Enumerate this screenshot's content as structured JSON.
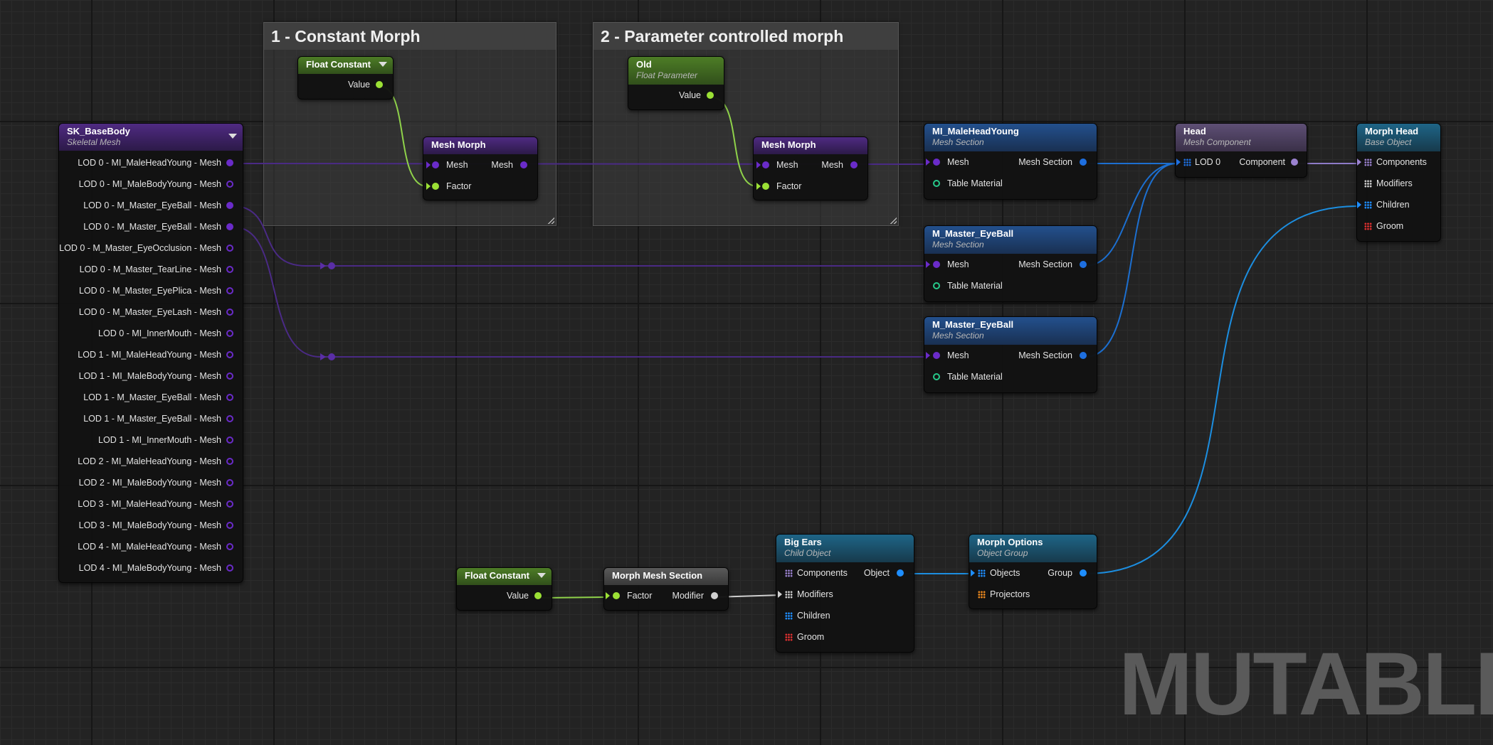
{
  "comments": [
    {
      "title": "1 - Constant Morph"
    },
    {
      "title": "2 - Parameter controlled morph"
    }
  ],
  "sk_base_body": {
    "title": "SK_BaseBody",
    "subtitle": "Skeletal Mesh",
    "outputs": [
      "LOD 0 - MI_MaleHeadYoung - Mesh",
      "LOD 0 - MI_MaleBodyYoung - Mesh",
      "LOD 0 - M_Master_EyeBall - Mesh",
      "LOD 0 - M_Master_EyeBall - Mesh",
      "LOD 0 - M_Master_EyeOcclusion - Mesh",
      "LOD 0 - M_Master_TearLine - Mesh",
      "LOD 0 - M_Master_EyePlica - Mesh",
      "LOD 0 - M_Master_EyeLash - Mesh",
      "LOD 0 - MI_InnerMouth - Mesh",
      "LOD 1 - MI_MaleHeadYoung - Mesh",
      "LOD 1 - MI_MaleBodyYoung - Mesh",
      "LOD 1 - M_Master_EyeBall - Mesh",
      "LOD 1 - M_Master_EyeBall - Mesh",
      "LOD 1 - MI_InnerMouth - Mesh",
      "LOD 2 - MI_MaleHeadYoung - Mesh",
      "LOD 2 - MI_MaleBodyYoung - Mesh",
      "LOD 3 - MI_MaleHeadYoung - Mesh",
      "LOD 3 - MI_MaleBodyYoung - Mesh",
      "LOD 4 - MI_MaleHeadYoung - Mesh",
      "LOD 4 - MI_MaleBodyYoung - Mesh"
    ]
  },
  "float_constant_1": {
    "title": "Float Constant",
    "value": "Value"
  },
  "mesh_morph_1": {
    "title": "Mesh Morph",
    "in_mesh": "Mesh",
    "in_factor": "Factor",
    "out_mesh": "Mesh"
  },
  "old_param": {
    "title": "Old",
    "subtitle": "Float Parameter",
    "value": "Value"
  },
  "mesh_morph_2": {
    "title": "Mesh Morph",
    "in_mesh": "Mesh",
    "in_factor": "Factor",
    "out_mesh": "Mesh"
  },
  "mesh_sections": [
    {
      "title": "MI_MaleHeadYoung",
      "subtitle": "Mesh Section",
      "in_mesh": "Mesh",
      "in_table": "Table Material",
      "out": "Mesh Section"
    },
    {
      "title": "M_Master_EyeBall",
      "subtitle": "Mesh Section",
      "in_mesh": "Mesh",
      "in_table": "Table Material",
      "out": "Mesh Section"
    },
    {
      "title": "M_Master_EyeBall",
      "subtitle": "Mesh Section",
      "in_mesh": "Mesh",
      "in_table": "Table Material",
      "out": "Mesh Section"
    }
  ],
  "head": {
    "title": "Head",
    "subtitle": "Mesh Component",
    "in_lod": "LOD 0",
    "out": "Component"
  },
  "morph_head": {
    "title": "Morph Head",
    "subtitle": "Base Object",
    "pins": [
      "Components",
      "Modifiers",
      "Children",
      "Groom"
    ]
  },
  "float_constant_2": {
    "title": "Float Constant",
    "value": "Value"
  },
  "morph_mesh_section": {
    "title": "Morph Mesh Section",
    "in_factor": "Factor",
    "out": "Modifier"
  },
  "big_ears": {
    "title": "Big Ears",
    "subtitle": "Child Object",
    "pins": [
      "Components",
      "Modifiers",
      "Children",
      "Groom"
    ],
    "out": "Object"
  },
  "morph_options": {
    "title": "Morph Options",
    "subtitle": "Object Group",
    "pins": [
      "Objects",
      "Projectors"
    ],
    "out": "Group"
  },
  "watermark": "MUTABLE",
  "colors": {
    "mesh_pin": "#8a2be2",
    "float_pin": "#9be035",
    "section_pin": "#1e8eff",
    "table_pin": "#27c98a",
    "component_pin": "#a07ed8",
    "modifier_pin": "#d0d0d0",
    "groom_pin": "#e03030",
    "projector_pin": "#ee8a1e"
  }
}
